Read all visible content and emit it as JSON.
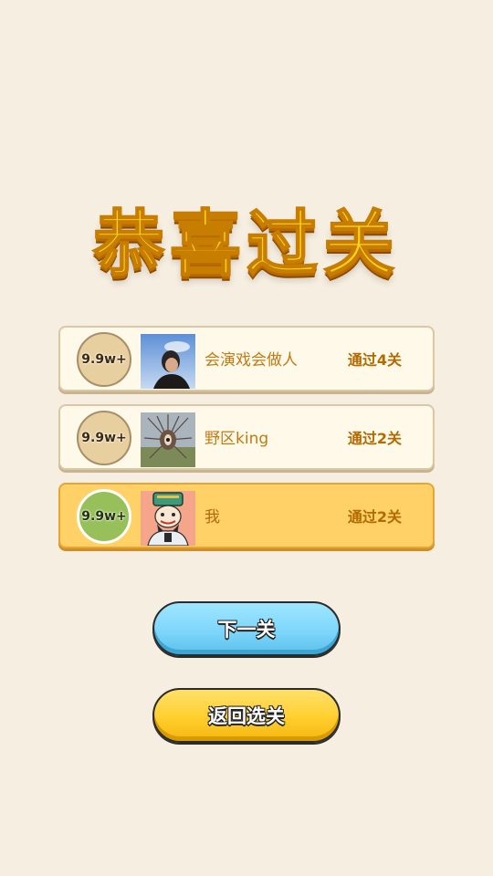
{
  "title": "恭喜过关",
  "leaderboard": [
    {
      "score": "9.9w+",
      "avatar": "avatar-photo-person",
      "name": "会演戏会做人",
      "passed": "通过4关",
      "is_me": false
    },
    {
      "score": "9.9w+",
      "avatar": "avatar-photo-eye",
      "name": "野区king",
      "passed": "通过2关",
      "is_me": false
    },
    {
      "score": "9.9w+",
      "avatar": "avatar-cartoon-opera",
      "name": "我",
      "passed": "通过2关",
      "is_me": true
    }
  ],
  "buttons": {
    "next": "下一关",
    "back": "返回选关"
  },
  "colors": {
    "background": "#f6eee0",
    "title": "#ffd21c",
    "me_row": "#ffd166",
    "next_button": "#7fd6fb",
    "back_button": "#ffcf2e"
  }
}
